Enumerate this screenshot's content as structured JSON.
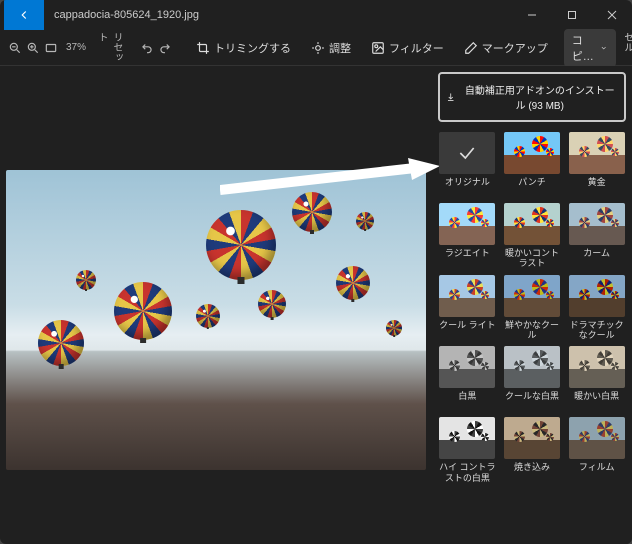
{
  "titlebar": {
    "title": "cappadocia-805624_1920.jpg"
  },
  "toolbar": {
    "zoom": "37%",
    "reset": "リセット",
    "crop": "トリミングする",
    "adjust": "調整",
    "filter": "フィルター",
    "markup": "マークアップ",
    "copy": "コピ…",
    "cancel": "キャンセル"
  },
  "panel": {
    "install": "自動補正用アドオンのインストール (93 MB)",
    "filters": [
      {
        "key": "original",
        "label": "オリジナル"
      },
      {
        "key": "punch",
        "label": "パンチ"
      },
      {
        "key": "gold",
        "label": "黄金"
      },
      {
        "key": "radiate",
        "label": "ラジエイト"
      },
      {
        "key": "warm",
        "label": "暖かいコントラスト"
      },
      {
        "key": "calm",
        "label": "カーム"
      },
      {
        "key": "coollt",
        "label": "クール ライト"
      },
      {
        "key": "vivid",
        "label": "鮮やかなクール"
      },
      {
        "key": "drama",
        "label": "ドラマチックなクール"
      },
      {
        "key": "bw",
        "label": "白黒"
      },
      {
        "key": "coolbw",
        "label": "クールな白黒"
      },
      {
        "key": "warmbw",
        "label": "暖かい白黒"
      },
      {
        "key": "hibw",
        "label": "ハイ コントラストの白黒"
      },
      {
        "key": "burn",
        "label": "焼き込み"
      },
      {
        "key": "film",
        "label": "フィルム"
      }
    ]
  }
}
